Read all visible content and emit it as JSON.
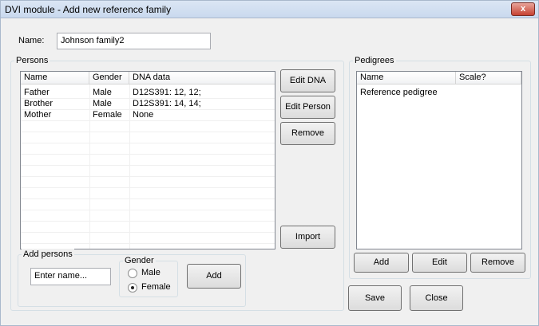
{
  "window": {
    "title": "DVI module - Add new reference family",
    "close_label": "x"
  },
  "name_field": {
    "label": "Name:",
    "value": "Johnson family2"
  },
  "persons": {
    "title": "Persons",
    "columns": [
      "Name",
      "Gender",
      "DNA data"
    ],
    "rows": [
      [
        "Father",
        "Male",
        "D12S391: 12, 12;"
      ],
      [
        "Brother",
        "Male",
        "D12S391: 14, 14;"
      ],
      [
        "Mother",
        "Female",
        "None"
      ]
    ],
    "buttons": {
      "edit_dna": "Edit DNA",
      "edit_person": "Edit Person",
      "remove": "Remove",
      "import": "Import"
    }
  },
  "add_persons": {
    "title": "Add persons",
    "name_placeholder": "Enter name...",
    "gender_title": "Gender",
    "gender_options": [
      "Male",
      "Female"
    ],
    "gender_selected": "Female",
    "add_label": "Add"
  },
  "pedigrees": {
    "title": "Pedigrees",
    "columns": [
      "Name",
      "Scale?"
    ],
    "rows": [
      [
        "Reference pedigree",
        ""
      ]
    ],
    "buttons": {
      "add": "Add",
      "edit": "Edit",
      "remove": "Remove"
    }
  },
  "footer": {
    "save_label": "Save",
    "close_label": "Close"
  }
}
